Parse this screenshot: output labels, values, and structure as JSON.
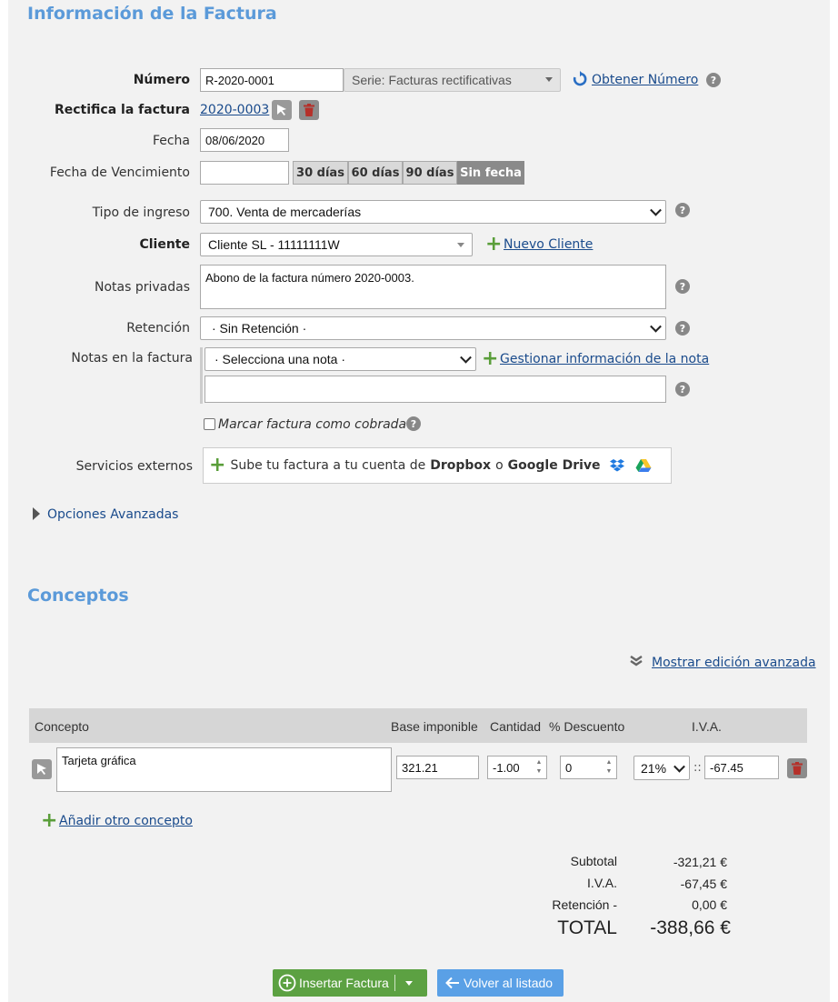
{
  "section1": {
    "title": "Información de la Factura"
  },
  "numero": {
    "label": "Número",
    "value": "R-2020-0001",
    "serie": "Serie: Facturas rectificativas",
    "obtener": "Obtener Número"
  },
  "rectifica": {
    "label": "Rectifica la factura",
    "link": "2020-0003"
  },
  "fecha": {
    "label": "Fecha",
    "value": "08/06/2020"
  },
  "vencimiento": {
    "label": "Fecha de Vencimiento",
    "value": "",
    "buttons": [
      "30 días",
      "60 días",
      "90 días",
      "Sin fecha"
    ],
    "active": "Sin fecha"
  },
  "tipo_ingreso": {
    "label": "Tipo de ingreso",
    "value": "700. Venta de mercaderías"
  },
  "cliente": {
    "label": "Cliente",
    "value": "Cliente SL - 11111111W",
    "nuevo": "Nuevo Cliente"
  },
  "notas_privadas": {
    "label": "Notas privadas",
    "value": "Abono de la factura número 2020-0003."
  },
  "retencion": {
    "label": "Retención",
    "value": "· Sin Retención ·"
  },
  "notas_factura": {
    "label": "Notas en la factura",
    "select": "· Selecciona una nota ·",
    "gestionar": "Gestionar información de la nota",
    "value": ""
  },
  "cobrada": {
    "label": "Marcar factura como cobrada",
    "checked": false
  },
  "externos": {
    "label": "Servicios externos",
    "text1": "Sube tu factura a tu cuenta de",
    "dropbox": "Dropbox",
    "o": "o",
    "gdrive": "Google Drive"
  },
  "avanzadas": {
    "label": "Opciones Avanzadas"
  },
  "section2": {
    "title": "Conceptos"
  },
  "edicion": {
    "label": "Mostrar edición avanzada"
  },
  "table": {
    "headers": {
      "concepto": "Concepto",
      "base": "Base imponible",
      "cantidad": "Cantidad",
      "descuento": "% Descuento",
      "iva": "I.V.A."
    },
    "row": {
      "concepto": "Tarjeta gráfica",
      "base": "321.21",
      "cantidad": "-1.00",
      "descuento": "0",
      "iva_rate": "21%",
      "iva_sep": "::",
      "iva_value": "-67.45"
    }
  },
  "anadir": {
    "label": "Añadir otro concepto"
  },
  "totals": {
    "subtotal_label": "Subtotal",
    "subtotal": "-321,21 €",
    "iva_label": "I.V.A.",
    "iva": "-67,45 €",
    "retencion_label": "Retención -",
    "retencion": "0,00 €",
    "total_label": "TOTAL",
    "total": "-388,66 €"
  },
  "actions": {
    "insertar": "Insertar Factura",
    "volver": "Volver al listado"
  },
  "colors": {
    "accent": "#5b9ad9",
    "green": "#5a9e3a",
    "panel": "#f2f2f2",
    "link": "#1a4b8c"
  }
}
